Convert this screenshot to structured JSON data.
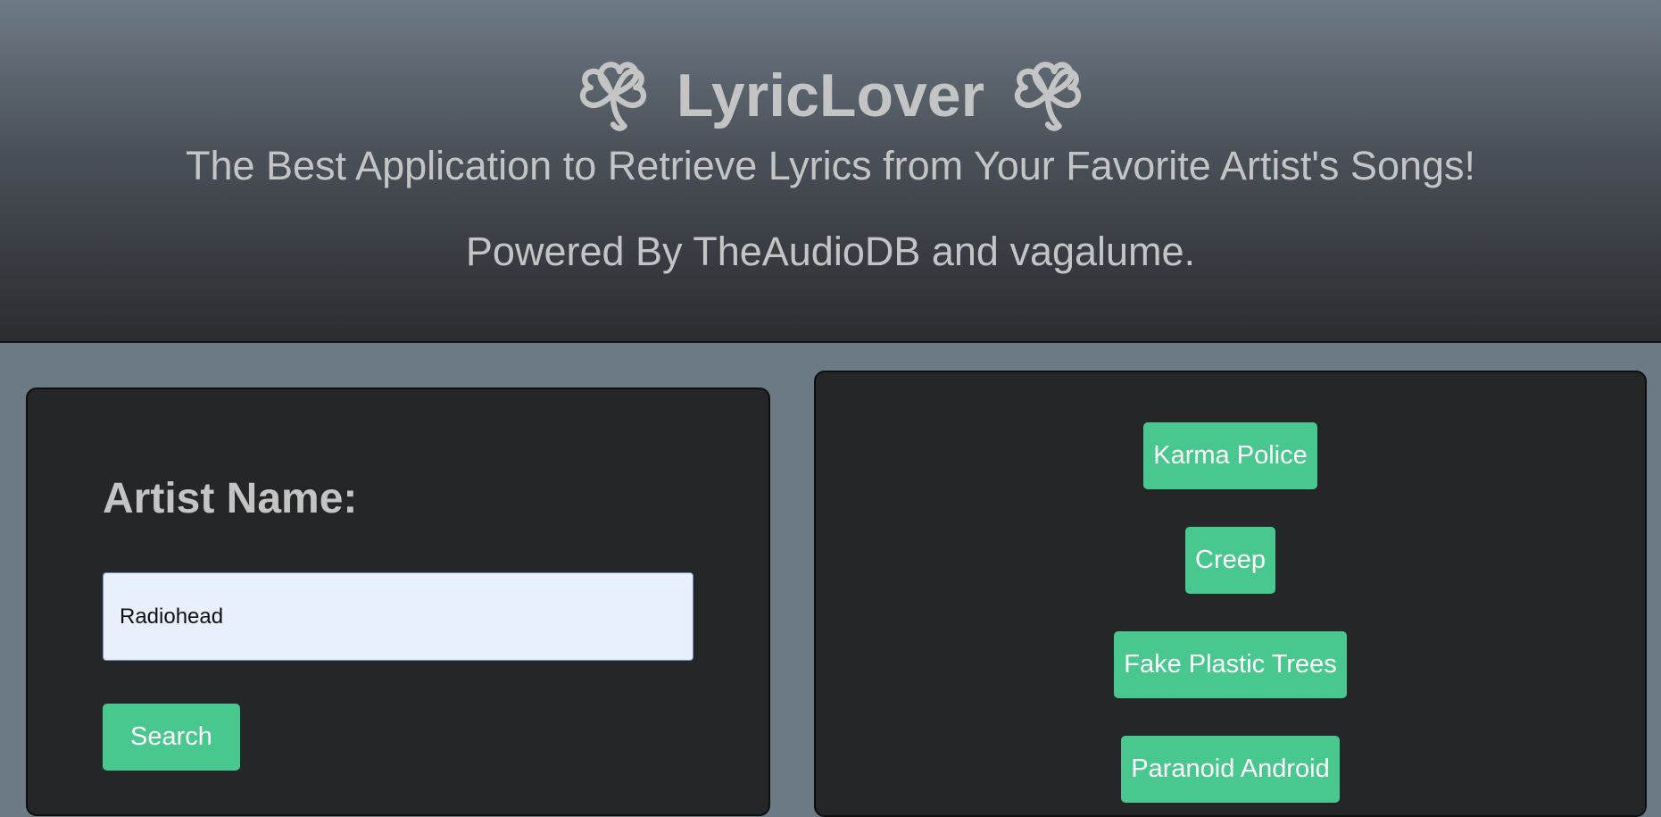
{
  "header": {
    "title": "LyricLover",
    "subtitle": "The Best Application to Retrieve Lyrics from Your Favorite Artist's Songs!",
    "powered_by": "Powered By TheAudioDB and vagalume.",
    "left_icon": "clover-icon",
    "right_icon": "clover-icon"
  },
  "search_form": {
    "label": "Artist Name:",
    "input_value": "Radiohead",
    "button_label": "Search"
  },
  "songs": {
    "items": [
      {
        "label": "Karma Police"
      },
      {
        "label": "Creep"
      },
      {
        "label": "Fake Plastic Trees"
      },
      {
        "label": "Paranoid Android"
      }
    ]
  },
  "colors": {
    "page_background": "#6c7a86",
    "panel_background": "#252628",
    "accent_button": "#48c78e",
    "text_light": "#c4c4c4",
    "input_background": "#e8effd"
  }
}
